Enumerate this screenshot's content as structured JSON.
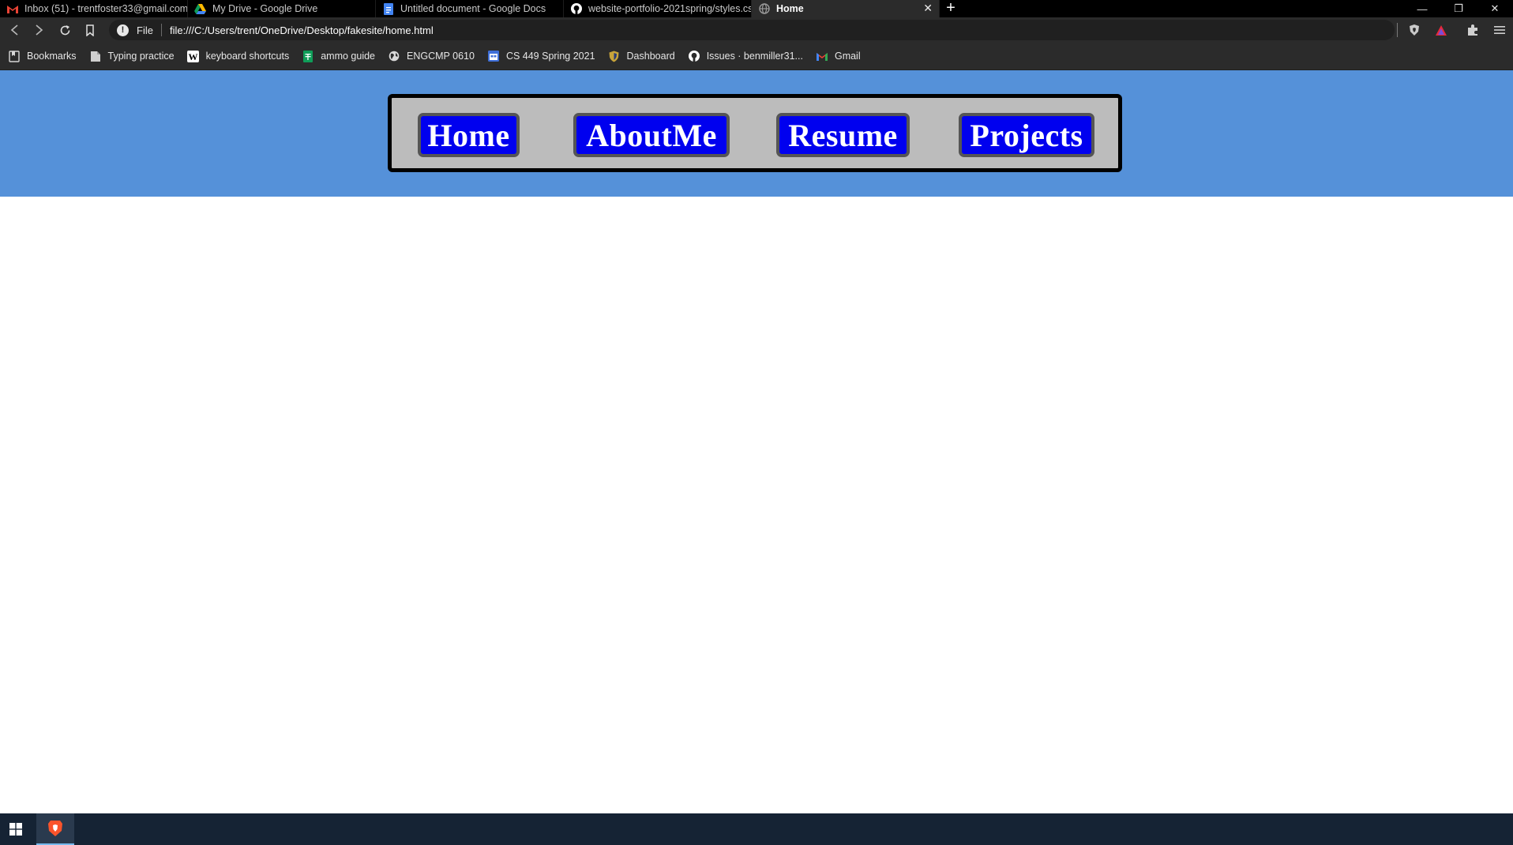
{
  "tabs": [
    {
      "label": "Inbox (51) - trentfoster33@gmail.com",
      "icon": "gmail-icon",
      "active": false
    },
    {
      "label": "My Drive - Google Drive",
      "icon": "google-drive-icon",
      "active": false
    },
    {
      "label": "Untitled document - Google Docs",
      "icon": "google-docs-icon",
      "active": false
    },
    {
      "label": "website-portfolio-2021spring/styles.cs",
      "icon": "github-icon",
      "active": false
    },
    {
      "label": "Home",
      "icon": "globe-icon",
      "active": true
    }
  ],
  "tab_close_glyph": "✕",
  "new_tab_glyph": "+",
  "window_controls": {
    "minimize": "—",
    "restore": "❐",
    "close": "✕"
  },
  "address_bar": {
    "scheme_label": "File",
    "url": "file:///C:/Users/trent/OneDrive/Desktop/fakesite/home.html"
  },
  "bookmarks": [
    {
      "label": "Bookmarks",
      "icon": "bookmarks-icon"
    },
    {
      "label": "Typing practice",
      "icon": "page-icon"
    },
    {
      "label": "keyboard shortcuts",
      "icon": "wikipedia-icon"
    },
    {
      "label": "ammo guide",
      "icon": "sheets-icon"
    },
    {
      "label": "ENGCMP 0610",
      "icon": "globe-icon"
    },
    {
      "label": "CS 449 Spring 2021",
      "icon": "calendar-icon"
    },
    {
      "label": "Dashboard",
      "icon": "shield-icon"
    },
    {
      "label": "Issues · benmiller31...",
      "icon": "github-icon"
    },
    {
      "label": "Gmail",
      "icon": "gmail-icon"
    }
  ],
  "site_nav": {
    "home": "Home",
    "about": "AboutMe",
    "resume": "Resume",
    "projects": "Projects"
  },
  "colors": {
    "header_bg": "#5591d9",
    "nav_box_bg": "#bcbcbc",
    "nav_button_bg": "#0000ef",
    "browser_chrome": "#2b2b2b",
    "taskbar_bg": "#152334"
  }
}
